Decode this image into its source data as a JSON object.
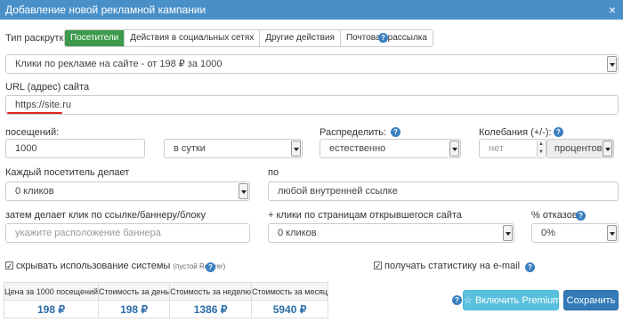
{
  "window": {
    "title": "Добавление новой рекламной кампании",
    "close_glyph": "×"
  },
  "promo_type": {
    "label": "Тип раскрутки:",
    "tabs": [
      "Посетители",
      "Действия в социальных сетях",
      "Другие действия",
      "Почтовая рассылка"
    ],
    "active_tab": 0
  },
  "help_glyph": "?",
  "campaign_select": {
    "value": "Клики по рекламе на сайте - от 198 ₽ за 1000"
  },
  "url": {
    "label": "URL (адрес) сайта",
    "value": "https://site.ru"
  },
  "visits": {
    "label": "посещений:",
    "value": "1000",
    "period": "в сутки"
  },
  "distribute": {
    "label": "Распределить:",
    "value": "естественно"
  },
  "fluctuation": {
    "label": "Колебания (+/-):",
    "placeholder": "нет",
    "unit": "процентов",
    "spin_up": "▲",
    "spin_down": "▼"
  },
  "each_visitor": {
    "label": "Каждый посетитель делает",
    "value": "0 кликов"
  },
  "by": {
    "label": "по",
    "value": "любой внутренней ссылке"
  },
  "banner_click": {
    "label": "затем делает клик по ссылке/баннеру/блоку",
    "placeholder": "укажите расположение баннера"
  },
  "extra_clicks": {
    "label": "+ клики по страницам открывшегося сайта",
    "value": "0 кликов"
  },
  "bounce": {
    "label": "% отказов",
    "value": "0%"
  },
  "hide_system": {
    "label": "скрывать использование системы",
    "note": "(пустой Referer)",
    "checked": true,
    "check_glyph": "✓"
  },
  "email_stats": {
    "label": "получать статистику на e-mail",
    "checked": true,
    "check_glyph": "✓"
  },
  "stats_table": {
    "headers": [
      "Цена за 1000 посещений",
      "Стоимость за день",
      "Стоимость за неделю",
      "Стоимость за месяц"
    ],
    "values": [
      "198 ₽",
      "198 ₽",
      "1386 ₽",
      "5940 ₽"
    ]
  },
  "buttons": {
    "premium": "Включить Premium",
    "premium_icon": "☆",
    "save": "Сохранить"
  },
  "colors": {
    "titlebar": "#4a90c8",
    "active_tab": "#3c9a4a",
    "premium": "#5bc0de",
    "save": "#337ab7",
    "link_value": "#2b6ca8",
    "underline": "#e02020"
  }
}
